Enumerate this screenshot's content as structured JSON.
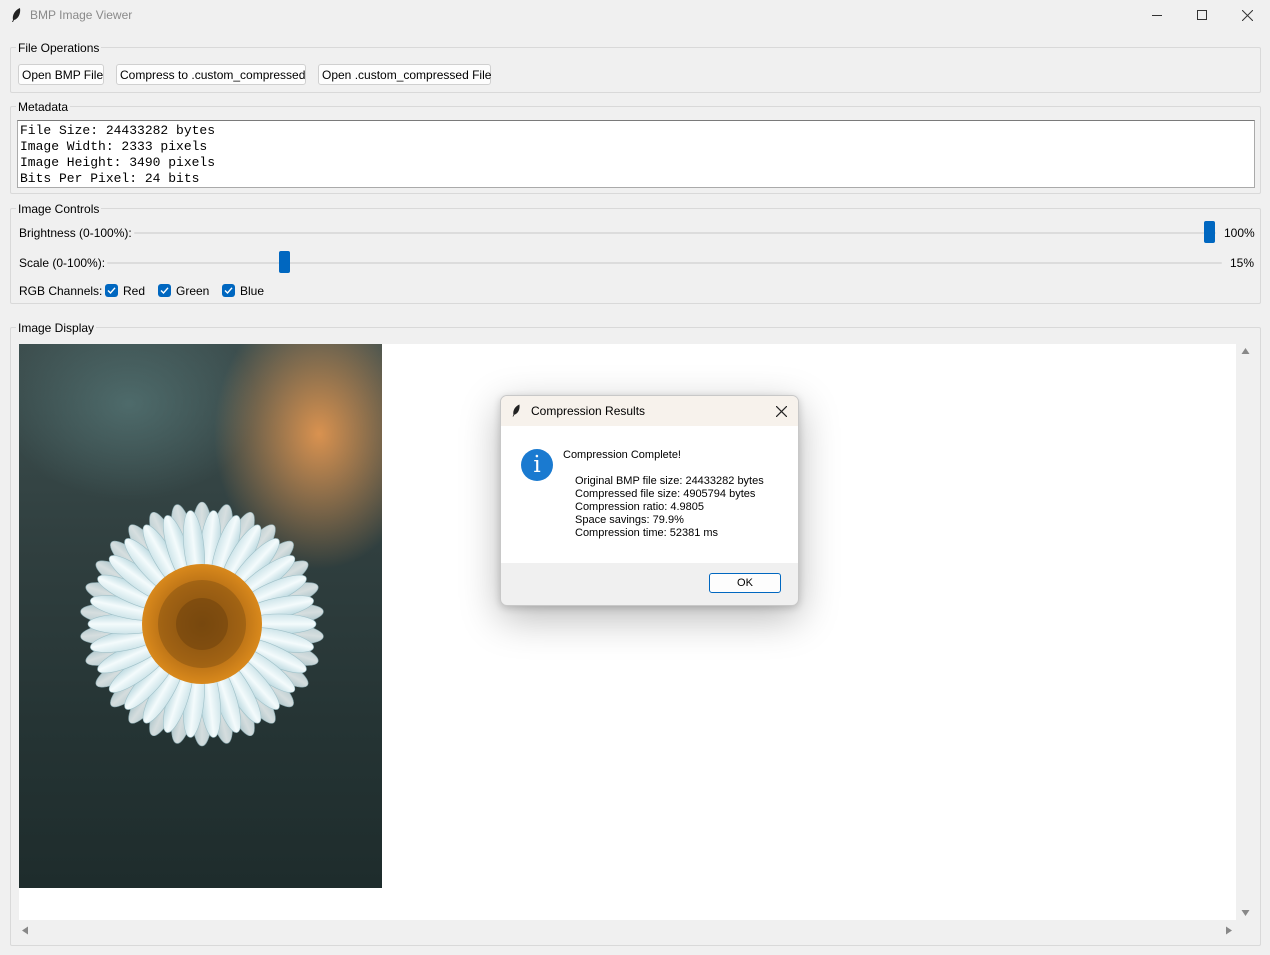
{
  "window": {
    "title": "BMP Image Viewer"
  },
  "file_ops": {
    "label": "File Operations",
    "open_bmp": "Open BMP File",
    "compress": "Compress to .custom_compressed",
    "open_custom": "Open .custom_compressed File"
  },
  "metadata": {
    "label": "Metadata",
    "lines": [
      "File Size: 24433282 bytes",
      "Image Width: 2333 pixels",
      "Image Height: 3490 pixels",
      "Bits Per Pixel: 24 bits"
    ]
  },
  "controls": {
    "label": "Image Controls",
    "brightness_label": "Brightness (0-100%):",
    "brightness_value": "100%",
    "brightness_level": 1.0,
    "scale_label": "Scale (0-100%):",
    "scale_value": "15%",
    "scale_level": 0.15,
    "rgb_label": "RGB Channels:",
    "channels": [
      {
        "name": "Red",
        "checked": true
      },
      {
        "name": "Green",
        "checked": true
      },
      {
        "name": "Blue",
        "checked": true
      }
    ]
  },
  "display": {
    "label": "Image Display"
  },
  "dialog": {
    "title": "Compression Results",
    "heading": "Compression Complete!",
    "lines": [
      "Original BMP file size: 24433282 bytes",
      "Compressed file size: 4905794 bytes",
      "Compression ratio: 4.9805",
      "Space savings: 79.9%",
      "Compression time: 52381 ms"
    ],
    "ok": "OK"
  },
  "colors": {
    "accent": "#0067c0",
    "window_bg": "#f0f0f0"
  }
}
